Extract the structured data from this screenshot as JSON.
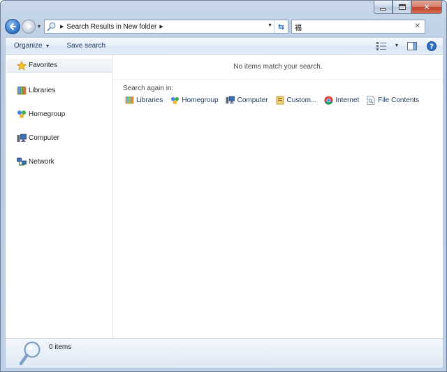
{
  "address_bar": {
    "path": "Search Results in New folder"
  },
  "search_box": {
    "value": "福"
  },
  "toolbar": {
    "organize_label": "Organize",
    "save_search_label": "Save search"
  },
  "navigation_pane": {
    "items": [
      {
        "label": "Favorites",
        "icon": "star-icon"
      },
      {
        "label": "Libraries",
        "icon": "libraries-icon"
      },
      {
        "label": "Homegroup",
        "icon": "homegroup-icon"
      },
      {
        "label": "Computer",
        "icon": "computer-icon"
      },
      {
        "label": "Network",
        "icon": "network-icon"
      }
    ]
  },
  "main": {
    "no_items_message": "No items match your search.",
    "search_again_label": "Search again in:",
    "search_again_options": [
      {
        "label": "Libraries",
        "icon": "libraries-icon"
      },
      {
        "label": "Homegroup",
        "icon": "homegroup-icon"
      },
      {
        "label": "Computer",
        "icon": "computer-icon"
      },
      {
        "label": "Custom...",
        "icon": "custom-folder-icon"
      },
      {
        "label": "Internet",
        "icon": "internet-browser-icon"
      },
      {
        "label": "File Contents",
        "icon": "file-contents-icon"
      }
    ]
  },
  "details_pane": {
    "count_text": "0 items"
  },
  "colors": {
    "frame": "#bcd0e8",
    "accent_blue": "#2c6fc4",
    "link_text": "#1e395b",
    "close_red": "#c2402a"
  }
}
